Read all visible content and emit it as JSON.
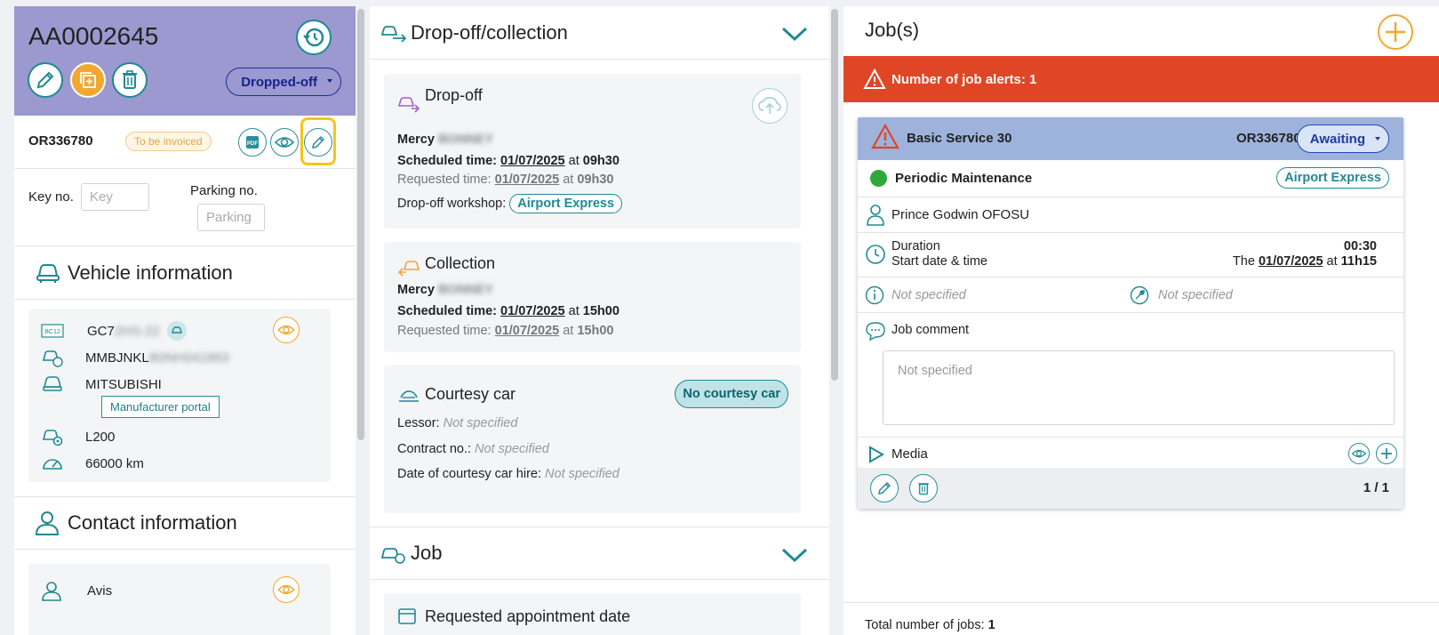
{
  "left": {
    "plate": "AA0002645",
    "status": "Dropped-off",
    "order_code": "OR336780",
    "invoice_badge": "To be invoiced",
    "key_label": "Key no.",
    "key_placeholder": "Key",
    "parking_label": "Parking no.",
    "parking_placeholder": "Parking",
    "vehicle_title": "Vehicle information",
    "vehicle": {
      "registration": "GC7",
      "registration_hidden": "2HS-22",
      "vin": "MMBJNKL",
      "vin_hidden": "B0NH041863",
      "make": "MITSUBISHI",
      "manufacturer_portal": "Manufacturer portal",
      "model": "L200",
      "mileage": "66000 km",
      "plate_icon_text": "BC12"
    },
    "contact_title": "Contact information",
    "contact_name": "Avis"
  },
  "middle": {
    "section_title": "Drop-off/collection",
    "dropoff": {
      "title": "Drop-off",
      "person": "Mercy",
      "person_hidden": "BONNEY",
      "scheduled_label": "Scheduled time:",
      "scheduled_date": "01/07/2025",
      "at": "at",
      "scheduled_time": "09h30",
      "requested_label": "Requested time:",
      "requested_date": "01/07/2025",
      "requested_time": "09h30",
      "workshop_label": "Drop-off workshop:",
      "workshop": "Airport Express"
    },
    "collection": {
      "title": "Collection",
      "person": "Mercy",
      "person_hidden": "BONNEY",
      "scheduled_label": "Scheduled time:",
      "scheduled_date": "01/07/2025",
      "at": "at",
      "scheduled_time": "15h00",
      "requested_label": "Requested time:",
      "requested_date": "01/07/2025",
      "requested_time": "15h00"
    },
    "courtesy": {
      "title": "Courtesy car",
      "badge": "No courtesy car",
      "lessor_label": "Lessor:",
      "contract_label": "Contract no.:",
      "hire_label": "Date of courtesy car hire:",
      "not_specified": "Not specified"
    },
    "job_title": "Job",
    "requested_appt": "Requested appointment date"
  },
  "right": {
    "title": "Job(s)",
    "alert": "Number of job alerts: 1",
    "job": {
      "name": "Basic Service 30",
      "order_code": "OR336780",
      "status": "Awaiting",
      "type": "Periodic Maintenance",
      "workshop": "Airport Express",
      "technician": "Prince Godwin OFOSU",
      "duration_label": "Duration",
      "duration": "00:30",
      "start_label": "Start date & time",
      "start_prefix": "The",
      "start_date": "01/07/2025",
      "start_at": "at",
      "start_time": "11h15",
      "info_value": "Not specified",
      "tool_value": "Not specified",
      "comment_label": "Job comment",
      "comment_placeholder": "Not specified",
      "media_label": "Media",
      "pagination": "1 / 1"
    },
    "total_label": "Total number of jobs:",
    "total_value": "1"
  },
  "colors": {
    "header_purple": "#9b99cf",
    "teal": "#1f8a95",
    "alert_red": "#e04625",
    "job_head_blue": "#9db3dc",
    "add_orange": "#f0a830",
    "highlight_yellow": "#f5c518"
  }
}
